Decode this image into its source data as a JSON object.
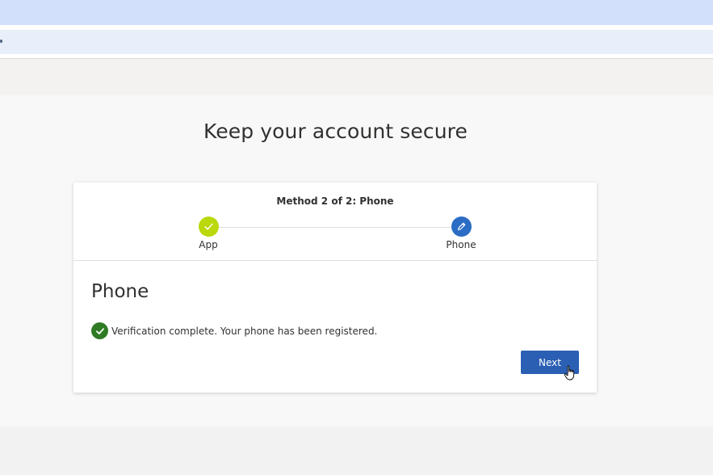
{
  "page": {
    "title": "Keep your account secure"
  },
  "wizard": {
    "method_label": "Method 2 of 2: Phone",
    "steps": [
      {
        "label": "App",
        "state": "complete",
        "icon": "check-icon",
        "color": "#bad80a"
      },
      {
        "label": "Phone",
        "state": "current",
        "icon": "pencil-icon",
        "color": "#2b6cc4"
      }
    ]
  },
  "section": {
    "title": "Phone",
    "status_icon": "success-check-icon",
    "status_color": "#2f7b24",
    "status_text": "Verification complete. Your phone has been registered."
  },
  "actions": {
    "next_label": "Next",
    "button_color": "#2b5fb4"
  }
}
